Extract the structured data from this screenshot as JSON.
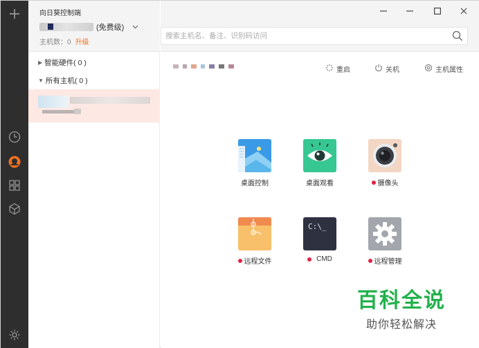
{
  "rail": {
    "icons": [
      "plus-icon",
      "clock-icon",
      "remote-logo-icon",
      "apps-grid-icon",
      "cube-icon",
      "settings-icon"
    ]
  },
  "sidebar": {
    "app_title": "向日葵控制端",
    "account_suffix": "(免费级)",
    "host_count_label": "主机数：0",
    "upgrade_label": "升级",
    "groups": [
      {
        "label": "智能硬件( 0 )"
      },
      {
        "label": "所有主机( 0 )"
      }
    ]
  },
  "search": {
    "placeholder": "搜索主机名、备注、识别码访问"
  },
  "window": {
    "minimize": "—",
    "maximize": "☐",
    "close": "✕"
  },
  "host_actions": {
    "restart_label": "重启",
    "shutdown_label": "关机",
    "properties_label": "主机属性"
  },
  "tiles": [
    {
      "label": "桌面控制",
      "dot": false
    },
    {
      "label": "桌面观看",
      "dot": false
    },
    {
      "label": "摄像头",
      "dot": true
    },
    {
      "label": "远程文件",
      "dot": true
    },
    {
      "label": "CMD",
      "dot": true,
      "icon_text": "C:\\_"
    },
    {
      "label": "远程管理",
      "dot": true
    }
  ],
  "watermark": {
    "title": "百科全说",
    "subtitle": "助你轻松解决"
  },
  "colors": {
    "rail_bg": "#2e2e2e",
    "accent_orange": "#f07020",
    "selected_row": "#fde8e4",
    "status_dot": "#e02244",
    "watermark_green": "#22b14c"
  }
}
